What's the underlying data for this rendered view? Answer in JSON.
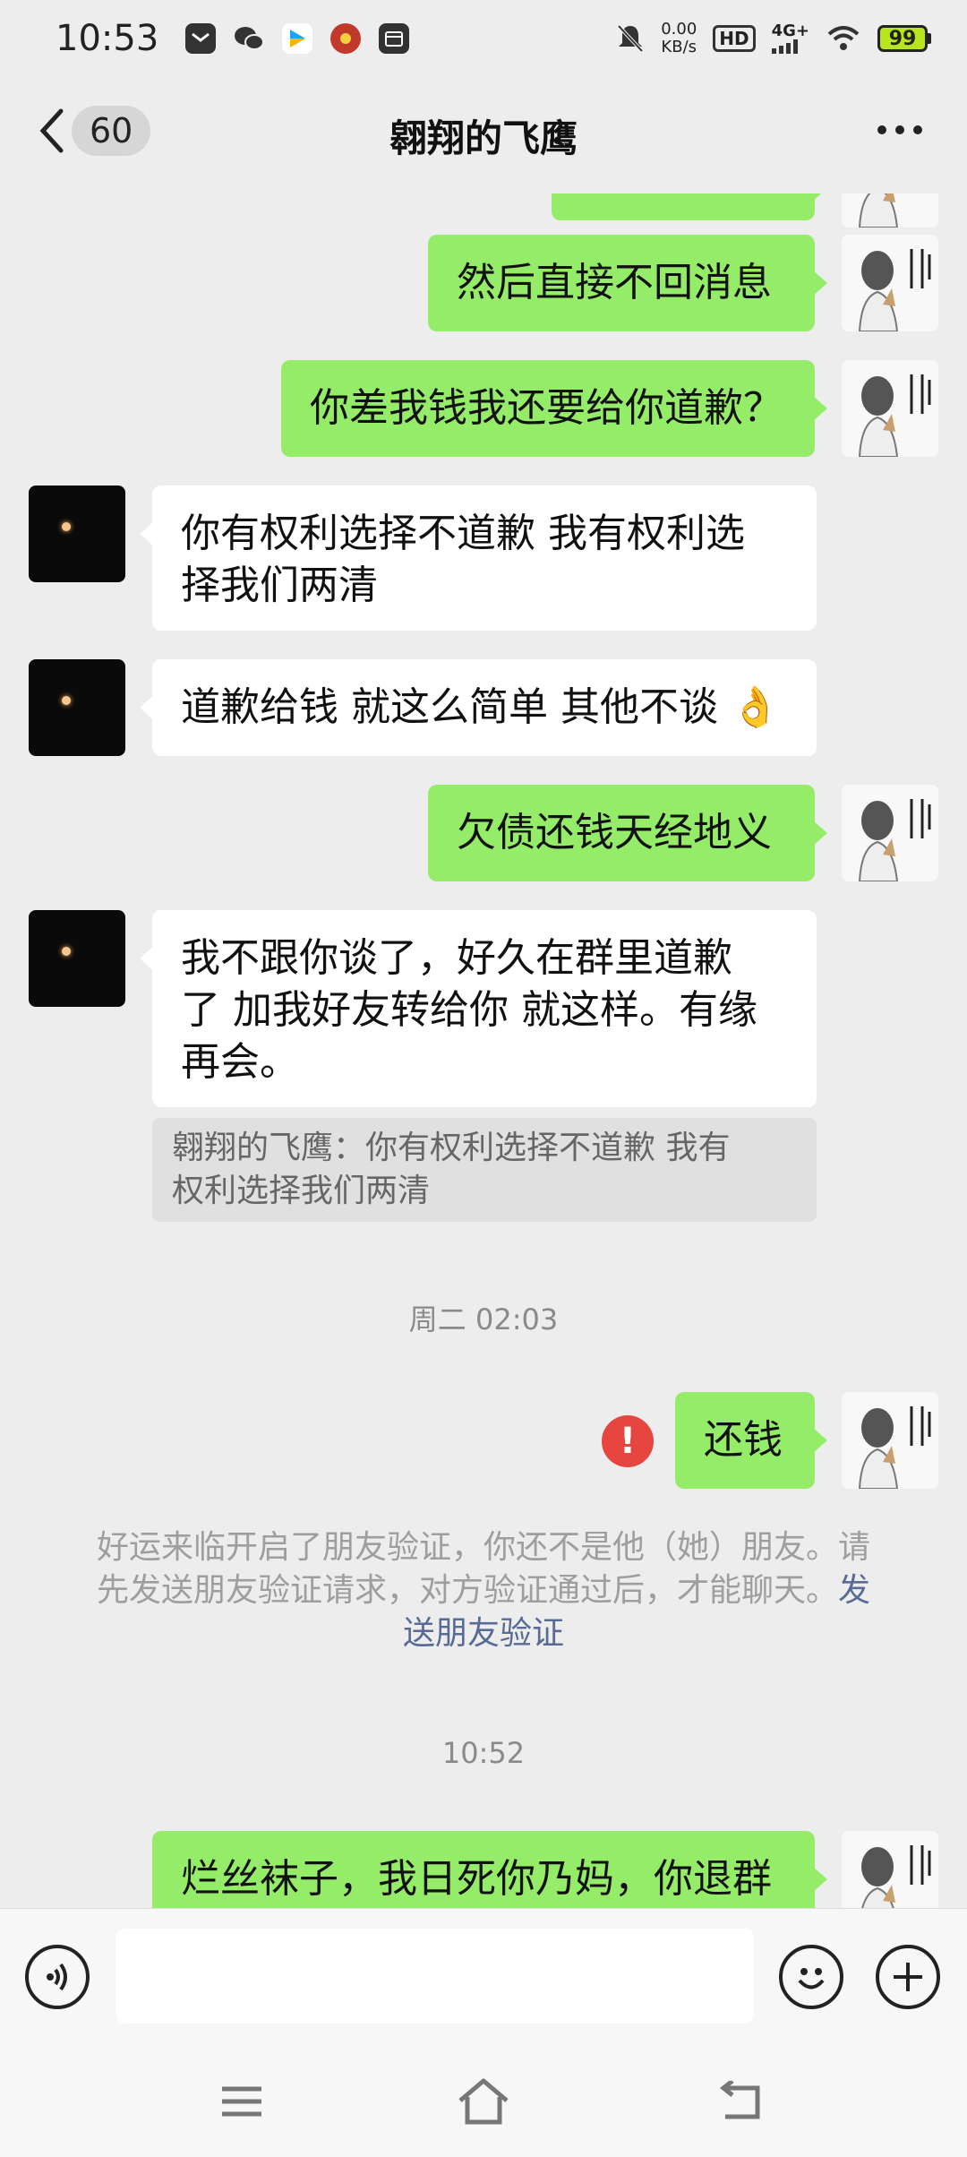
{
  "status_bar": {
    "time": "10:53",
    "net_speed_value": "0.00",
    "net_speed_unit": "KB/s",
    "hd_label": "HD",
    "network_label": "4G+",
    "battery": "99"
  },
  "header": {
    "unread_count": "60",
    "title": "翱翔的飞鹰"
  },
  "messages": {
    "m0": "",
    "m1": "然后直接不回消息",
    "m2": "你差我钱我还要给你道歉？",
    "m3_line1": "你有权利选择不道歉  我有权利选",
    "m3_line2": "择我们两清",
    "m4": "道歉给钱 就这么简单 其他不谈",
    "m4_emoji": "👌",
    "m5": "欠债还钱天经地义",
    "m6_line1": "我不跟你谈了，好久在群里道歉",
    "m6_line2": "了  加我好友转给你 就这样。有缘",
    "m6_line3": "再会。",
    "quote_line1": "翱翔的飞鹰：你有权利选择不道歉  我有",
    "quote_line2": "权利选择我们两清",
    "time1": "周二 02:03",
    "m7": "还钱",
    "error_mark": "!",
    "system_line1": "好运来临开启了朋友验证，你还不是他（她）朋友。请",
    "system_line2": "先发送朋友验证请求，对方验证通过后，才能聊天。",
    "system_link1": "发",
    "system_link2": "送朋友验证",
    "time2": "10:52",
    "m8": "烂丝袜子，我日死你乃妈，你退群"
  },
  "input": {
    "value": ""
  },
  "colors": {
    "bubble_self": "#95ec69",
    "bubble_other": "#ffffff",
    "link": "#576b95",
    "error": "#e7453f"
  }
}
